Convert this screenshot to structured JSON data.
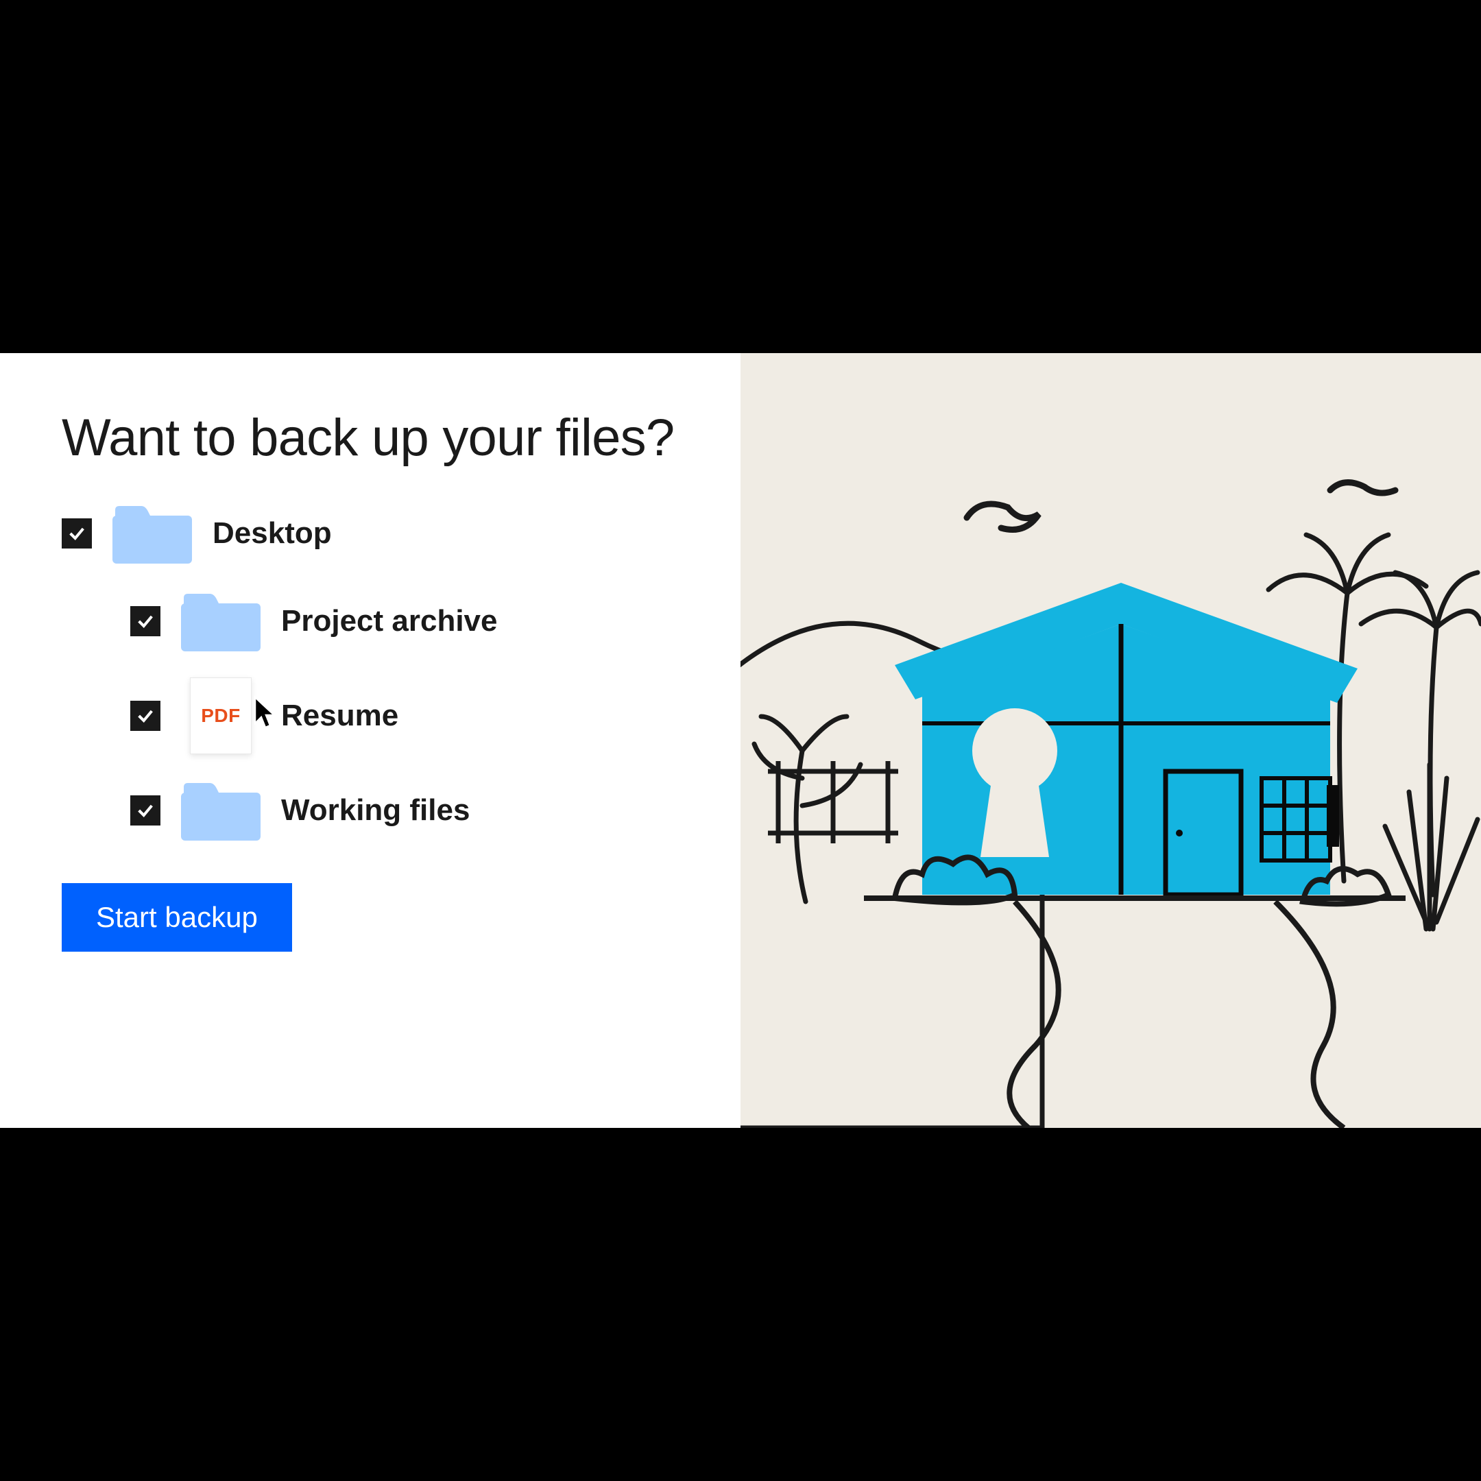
{
  "heading": "Want to back up your files?",
  "items": [
    {
      "label": "Desktop",
      "type": "folder",
      "checked": true,
      "depth": 0
    },
    {
      "label": "Project archive",
      "type": "folder",
      "checked": true,
      "depth": 1
    },
    {
      "label": "Resume",
      "type": "pdf",
      "checked": true,
      "depth": 1,
      "cursor": true,
      "pdf_badge": "PDF"
    },
    {
      "label": "Working files",
      "type": "folder",
      "checked": true,
      "depth": 1
    }
  ],
  "cta_label": "Start backup",
  "colors": {
    "folder": "#a8d0ff",
    "accent": "#0061fe",
    "pdf": "#e84e1b",
    "house": "#14b4e0",
    "bg_right": "#f0ece4"
  }
}
